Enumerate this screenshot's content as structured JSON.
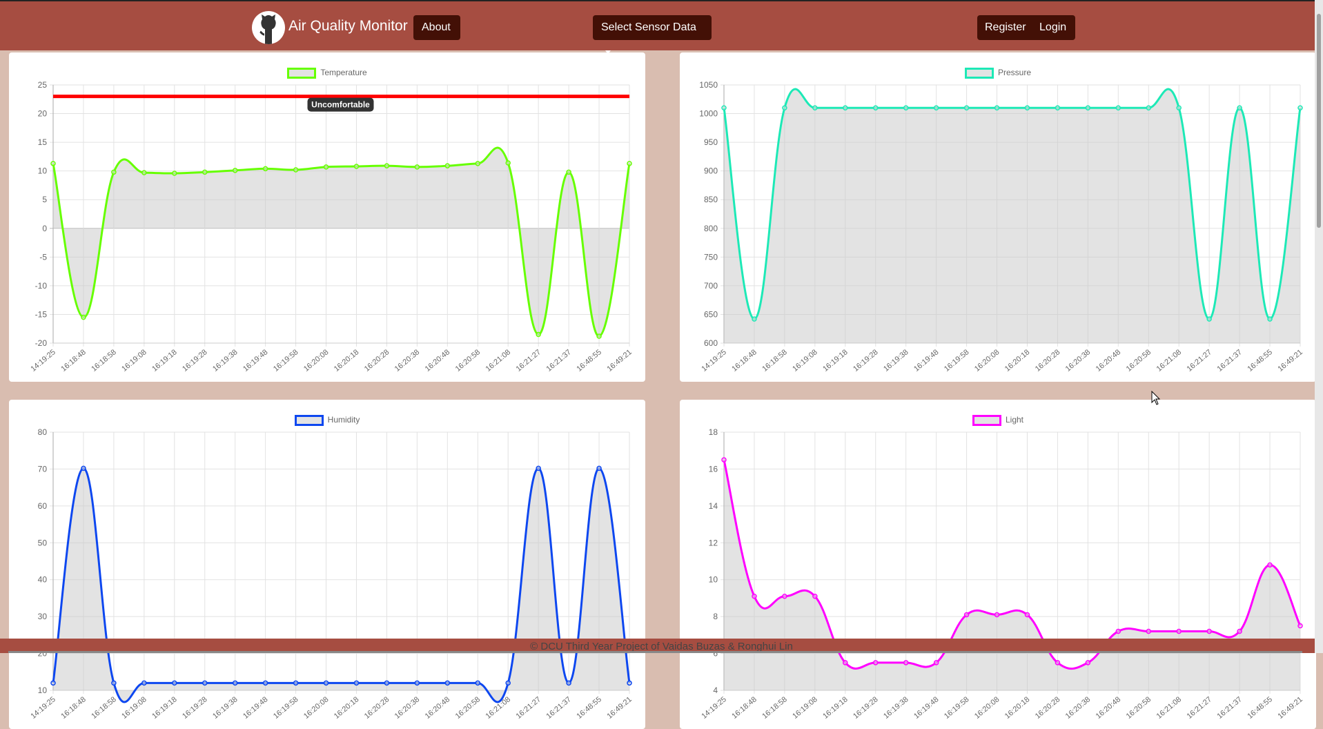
{
  "nav": {
    "brand": "Air Quality Monitor",
    "about": "About",
    "select_sensor": "Select Sensor Data",
    "register": "Register",
    "login": "Login"
  },
  "footer": {
    "text": "© DCU Third Year Project of Vaidas Buzas & Ronghui Lin"
  },
  "chart_data": [
    {
      "type": "line",
      "title": "",
      "legend": "Temperature",
      "color": "#66ff00",
      "legend_position": "top",
      "labels": [
        "14:19:25",
        "16:18:48",
        "16:18:58",
        "16:19:08",
        "16:19:18",
        "16:19:28",
        "16:19:38",
        "16:19:48",
        "16:19:58",
        "16:20:08",
        "16:20:18",
        "16:20:28",
        "16:20:38",
        "16:20:48",
        "16:20:58",
        "16:21:08",
        "16:21:27",
        "16:21:37",
        "16:48:55",
        "16:49:21"
      ],
      "values": [
        11.3,
        -15.5,
        9.8,
        9.7,
        9.6,
        9.8,
        10.1,
        10.4,
        10.2,
        10.7,
        10.8,
        10.9,
        10.7,
        10.9,
        11.3,
        11.4,
        -18.5,
        9.8,
        -18.8,
        11.3
      ],
      "ylim": [
        -20,
        25
      ],
      "yticks": [
        25,
        20,
        15,
        10,
        5,
        0,
        -5,
        -10,
        -15,
        -20
      ],
      "annotation": {
        "value": 23,
        "label": "Uncomfortable",
        "color": "#ff0000"
      }
    },
    {
      "type": "line",
      "legend": "Pressure",
      "color": "#1de9b6",
      "legend_position": "top",
      "labels": [
        "14:19:25",
        "16:18:48",
        "16:18:58",
        "16:19:08",
        "16:19:18",
        "16:19:28",
        "16:19:38",
        "16:19:48",
        "16:19:58",
        "16:20:08",
        "16:20:18",
        "16:20:28",
        "16:20:38",
        "16:20:48",
        "16:20:58",
        "16:21:08",
        "16:21:27",
        "16:21:37",
        "16:48:55",
        "16:49:21"
      ],
      "values": [
        1010,
        642,
        1010,
        1010,
        1010,
        1010,
        1010,
        1010,
        1010,
        1010,
        1010,
        1010,
        1010,
        1010,
        1010,
        1010,
        642,
        1010,
        642,
        1010
      ],
      "ylim": [
        600,
        1050
      ],
      "yticks": [
        1050,
        1000,
        950,
        900,
        850,
        800,
        750,
        700,
        650,
        600
      ]
    },
    {
      "type": "line",
      "legend": "Humidity",
      "color": "#0d47f0",
      "legend_position": "top",
      "labels": [
        "14:19:25",
        "16:18:48",
        "16:18:58",
        "16:19:08",
        "16:19:18",
        "16:19:28",
        "16:19:38",
        "16:19:48",
        "16:19:58",
        "16:20:08",
        "16:20:18",
        "16:20:28",
        "16:20:38",
        "16:20:48",
        "16:20:58",
        "16:21:08",
        "16:21:27",
        "16:21:37",
        "16:48:55",
        "16:49:21"
      ],
      "values": [
        12,
        70.2,
        12,
        12,
        12,
        12,
        12,
        12,
        12,
        12,
        12,
        12,
        12,
        12,
        12,
        12,
        70.2,
        12,
        70.2,
        12
      ],
      "ylim": [
        10,
        80
      ],
      "yticks": [
        80,
        70,
        60,
        50,
        40,
        30,
        20,
        10
      ]
    },
    {
      "type": "line",
      "legend": "Light",
      "color": "#ff00ff",
      "legend_position": "top",
      "labels": [
        "14:19:25",
        "16:18:48",
        "16:18:58",
        "16:19:08",
        "16:19:18",
        "16:19:28",
        "16:19:38",
        "16:19:48",
        "16:19:58",
        "16:20:08",
        "16:20:18",
        "16:20:28",
        "16:20:38",
        "16:20:48",
        "16:20:58",
        "16:21:08",
        "16:21:27",
        "16:21:37",
        "16:48:55",
        "16:49:21"
      ],
      "values": [
        16.5,
        9.1,
        9.1,
        9.1,
        5.5,
        5.5,
        5.5,
        5.5,
        8.1,
        8.1,
        8.1,
        5.5,
        5.5,
        7.2,
        7.2,
        7.2,
        7.2,
        7.2,
        10.8,
        7.5
      ],
      "ylim": [
        4,
        18
      ],
      "yticks": [
        18,
        16,
        14,
        12,
        10,
        8,
        6,
        4
      ]
    }
  ]
}
